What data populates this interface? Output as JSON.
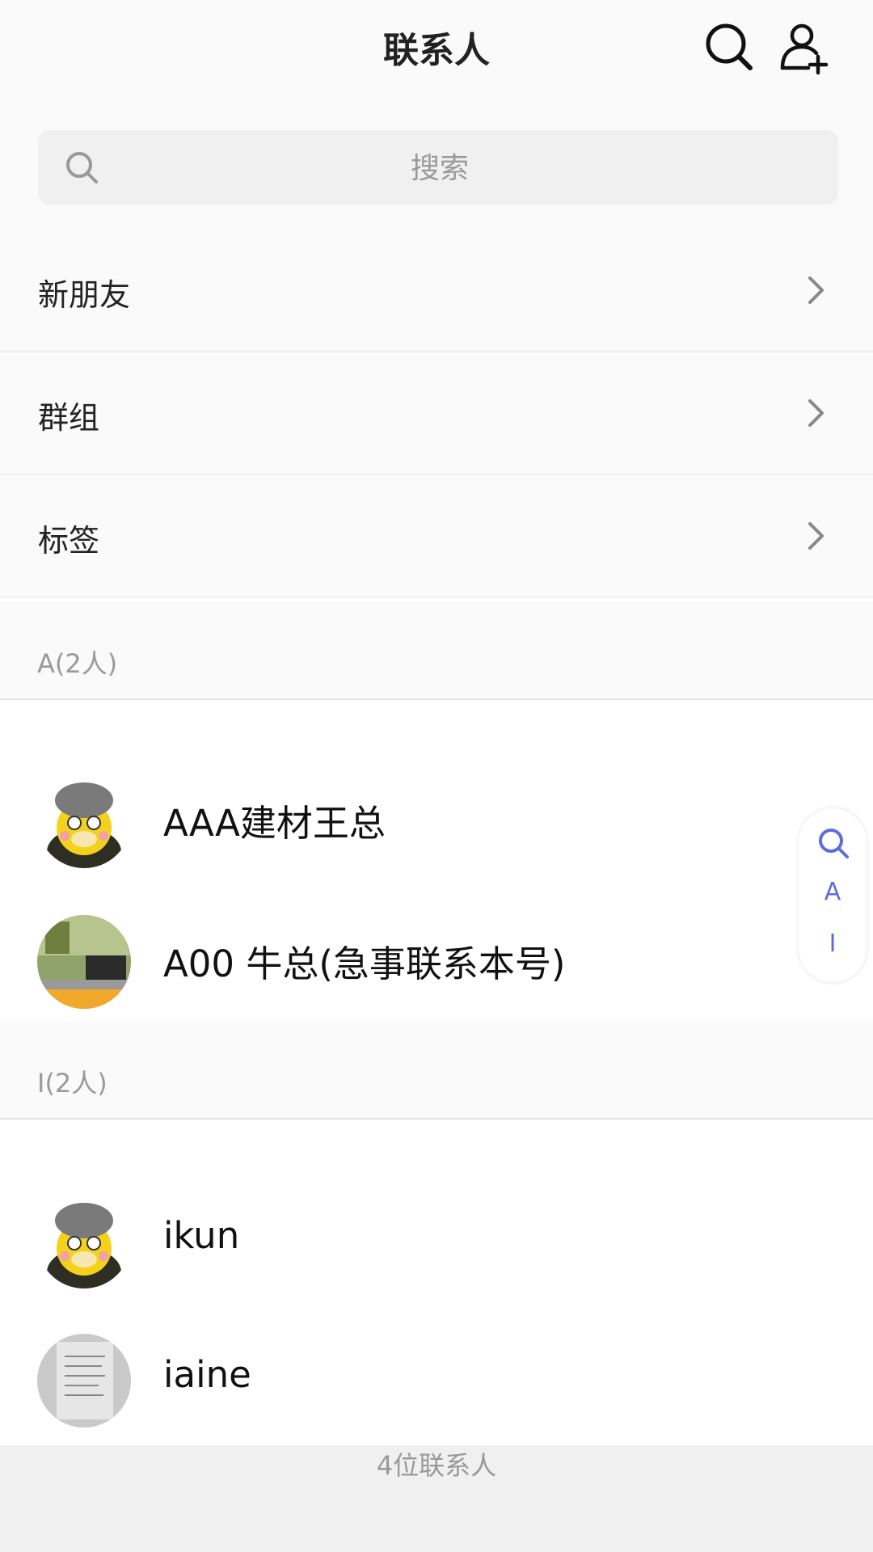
{
  "header": {
    "title": "联系人",
    "search_icon": "search-icon",
    "add_icon": "add-contact-icon"
  },
  "search": {
    "placeholder": "搜索"
  },
  "menu": [
    {
      "label": "新朋友",
      "icon": "chevron-right-icon"
    },
    {
      "label": "群组",
      "icon": "chevron-right-icon"
    },
    {
      "label": "标签",
      "icon": "chevron-right-icon"
    }
  ],
  "sections": [
    {
      "header": "A(2人)",
      "contacts": [
        {
          "name": "AAA建材王总"
        },
        {
          "name": "A00 牛总(急事联系本号)"
        }
      ]
    },
    {
      "header": "I(2人)",
      "contacts": [
        {
          "name": "ikun"
        },
        {
          "name": "iaine"
        }
      ]
    }
  ],
  "index_bar": {
    "letters": [
      "A",
      "I"
    ],
    "search_icon": "search-icon"
  },
  "footer": {
    "count_label": "4位联系人"
  },
  "colors": {
    "accent": "#5b6ee0",
    "background": "#fafafa",
    "footer": "#f0f0f0"
  }
}
